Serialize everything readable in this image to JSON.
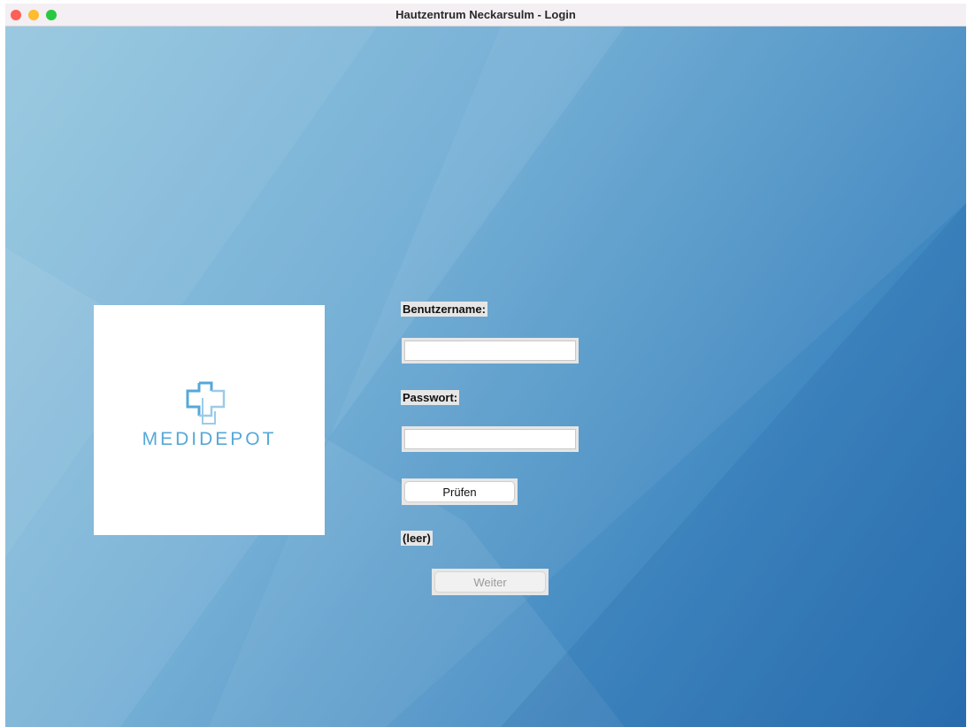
{
  "window": {
    "title": "Hautzentrum Neckarsulm - Login"
  },
  "logo": {
    "text": "MEDIDEPOT",
    "icon": "medical-cross-icon",
    "color": "#56a8d8"
  },
  "form": {
    "username_label": "Benutzername:",
    "username_value": "",
    "password_label": "Passwort:",
    "password_value": "",
    "check_button_label": "Prüfen",
    "status_text": "(leer)",
    "continue_button_label": "Weiter",
    "continue_button_enabled": false
  },
  "colors": {
    "background_light": "#8ec3de",
    "background_dark": "#2a6fb0",
    "close": "#fe5f57",
    "minimize": "#febc2e",
    "maximize": "#28c840"
  }
}
